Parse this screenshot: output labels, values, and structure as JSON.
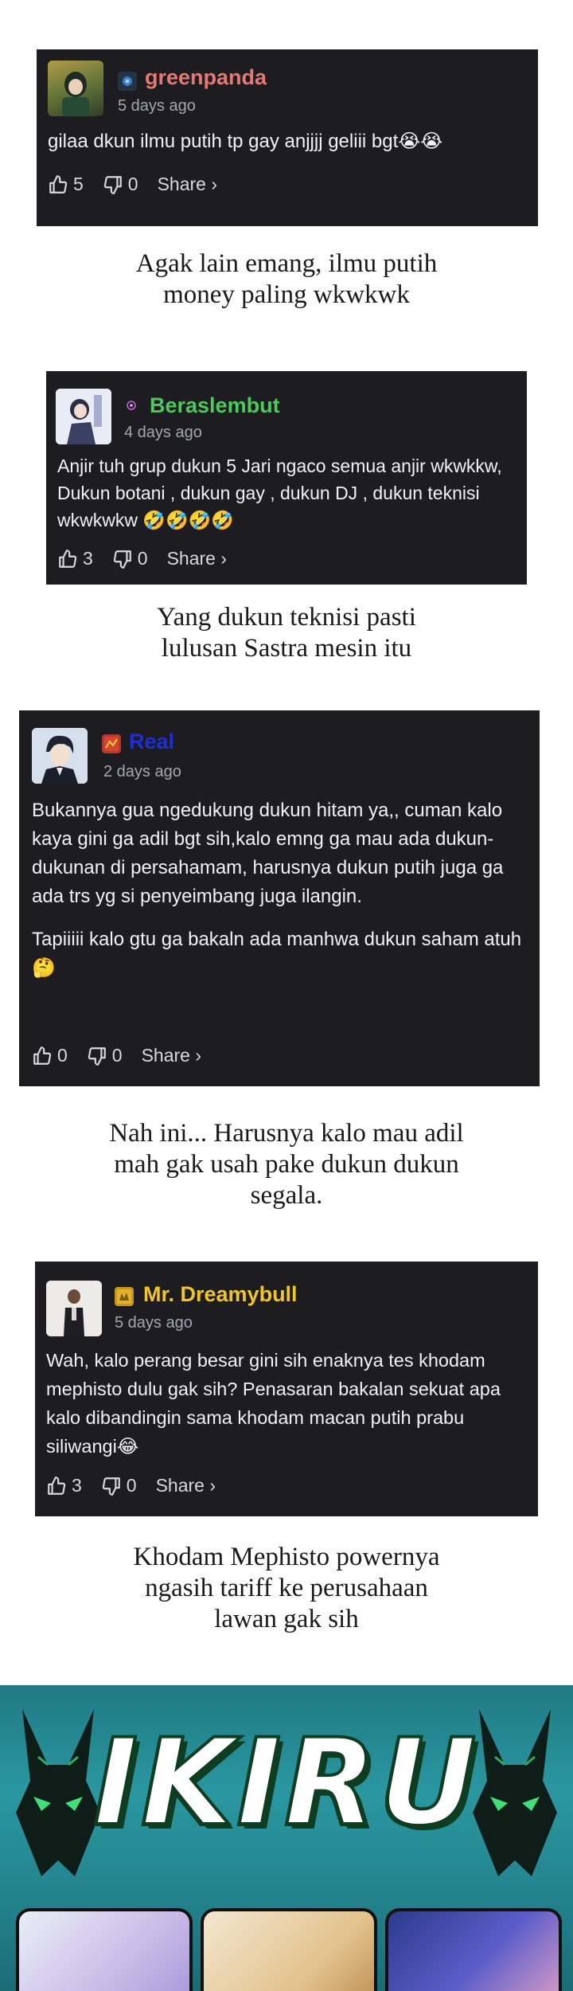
{
  "comments": [
    {
      "username": "greenpanda",
      "username_color": "#e57a74",
      "time": "5 days ago",
      "body": [
        "gilaa dkun ilmu putih tp gay anjjjj geliii bgt😭😭"
      ],
      "likes": "5",
      "dislikes": "0",
      "share_label": "Share ›"
    },
    {
      "username": "Beraslembut",
      "username_color": "#4cc95a",
      "time": "4 days ago",
      "body": [
        "Anjir tuh grup dukun 5 Jari ngaco semua anjir wkwkkw, Dukun botani , dukun gay , dukun DJ , dukun teknisi wkwkwkw 🤣🤣🤣🤣"
      ],
      "likes": "3",
      "dislikes": "0",
      "share_label": "Share ›"
    },
    {
      "username": "Real",
      "username_color": "#1f2fd8",
      "time": "2 days ago",
      "body": [
        "Bukannya gua ngedukung dukun hitam ya,, cuman kalo kaya gini ga adil bgt sih,kalo emng ga mau ada dukun-dukunan di persahamam, harusnya dukun putih juga ga ada trs yg si penyeimbang juga ilangin.",
        "Tapiiiii kalo gtu ga bakaln ada manhwa dukun saham atuh 🤔"
      ],
      "likes": "0",
      "dislikes": "0",
      "share_label": "Share ›"
    },
    {
      "username": "Mr. Dreamybull",
      "username_color": "#f0c52c",
      "time": "5 days ago",
      "body": [
        "Wah, kalo perang besar gini sih enaknya tes khodam mephisto dulu gak sih? Penasaran bakalan sekuat apa kalo dibandingin sama khodam macan putih prabu siliwangi😂"
      ],
      "likes": "3",
      "dislikes": "0",
      "share_label": "Share ›"
    }
  ],
  "captions": [
    "Agak lain emang, ilmu putih money paling wkwkwk",
    "Yang dukun teknisi pasti lulusan Sastra mesin itu",
    "Nah ini... Harusnya kalo mau adil mah gak usah pake dukun dukun segala.",
    "Khodam Mephisto powernya ngasih tariff ke perusahaan lawan gak sih"
  ],
  "banner": {
    "title": "IKIRU"
  },
  "icons": {
    "like": "thumbs-up-icon",
    "dislike": "thumbs-down-icon",
    "logo": "jackal-head-icon"
  }
}
